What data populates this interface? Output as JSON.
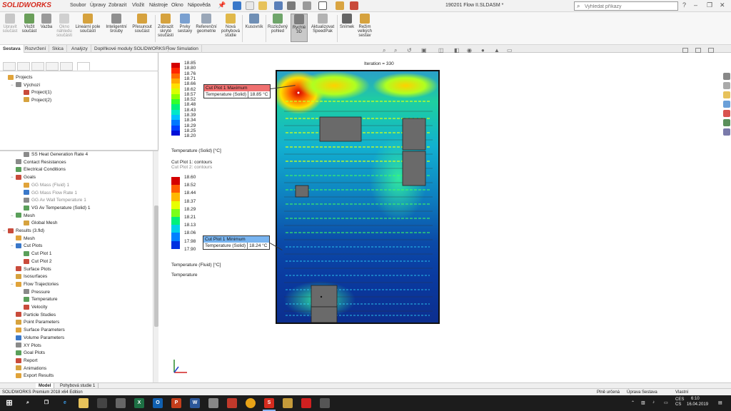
{
  "app": {
    "logo": "SOLIDWORKS",
    "menu": [
      "Soubor",
      "Úpravy",
      "Zobrazit",
      "Vložit",
      "Nástroje",
      "Okno",
      "Nápověda"
    ],
    "document_title": "190201 Flow II.SLDASM *",
    "search_placeholder": "Vyhledat příkazy",
    "colors": {
      "logo": "#d52b1e",
      "accent": "#1f6fd1",
      "max_callout": "#f07070",
      "min_callout": "#78b4f0"
    }
  },
  "ribbon": {
    "buttons": [
      {
        "label": "Upravit\nsoučást",
        "icon": "edit-component-icon",
        "disabled": true
      },
      {
        "label": "Vložit\nsoučást",
        "icon": "insert-component-icon"
      },
      {
        "label": "Vazba",
        "icon": "mate-icon"
      },
      {
        "label": "Okno\nnáhledu\nsoučásti",
        "icon": "preview-window-icon",
        "disabled": true
      },
      {
        "label": "Lineární pole\nsoučástí",
        "icon": "linear-pattern-icon"
      },
      {
        "label": "Inteligentní\nšrouby",
        "icon": "smart-fasteners-icon"
      },
      {
        "label": "Přesunout\nsoučást",
        "icon": "move-component-icon"
      },
      {
        "label": "Zobrazit\nskryté\nsoučásti",
        "icon": "show-hidden-icon"
      },
      {
        "label": "Prvky\nsestavy",
        "icon": "assembly-features-icon"
      },
      {
        "label": "Referenční\ngeometrie",
        "icon": "reference-geometry-icon"
      },
      {
        "label": "Nová\npohybová\nstudie",
        "icon": "motion-study-icon"
      },
      {
        "label": "Kusovník",
        "icon": "bom-icon"
      },
      {
        "label": "Rozložený\npohled",
        "icon": "exploded-view-icon"
      },
      {
        "label": "Rychlé\n3D",
        "icon": "instant3d-icon",
        "active": true
      },
      {
        "label": "Aktualizovat\nSpeedPak",
        "icon": "speedpak-icon"
      },
      {
        "label": "Snímek",
        "icon": "snapshot-icon"
      },
      {
        "label": "Režim\nvelkých\nsestav",
        "icon": "large-assembly-icon"
      }
    ]
  },
  "command_tabs": [
    "Sestava",
    "Rozvržení",
    "Skica",
    "Analýzy",
    "Doplňkové moduly SOLIDWORKS",
    "Flow Simulation"
  ],
  "tree_top": [
    {
      "label": "Projects",
      "indent": 0,
      "exp": ""
    },
    {
      "label": "Výchozí",
      "indent": 1,
      "exp": "−"
    },
    {
      "label": "Project(1)",
      "indent": 2,
      "exp": ""
    },
    {
      "label": "Project(2)",
      "indent": 2,
      "exp": ""
    }
  ],
  "tree": [
    {
      "label": "SS Heat Generation Rate 4",
      "indent": 2,
      "exp": "",
      "grey": false
    },
    {
      "label": "Contact Resistances",
      "indent": 1,
      "exp": "",
      "grey": false
    },
    {
      "label": "Electrical Conditions",
      "indent": 1,
      "exp": "",
      "grey": false
    },
    {
      "label": "Goals",
      "indent": 1,
      "exp": "−",
      "grey": false
    },
    {
      "label": "GG Mass (Fluid) 1",
      "indent": 2,
      "exp": "",
      "grey": true
    },
    {
      "label": "GG Mass Flow Rate 1",
      "indent": 2,
      "exp": "",
      "grey": true
    },
    {
      "label": "GG Av Wall Temperature 1",
      "indent": 2,
      "exp": "",
      "grey": true
    },
    {
      "label": "VG Av Temperature (Solid) 1",
      "indent": 2,
      "exp": "",
      "grey": false
    },
    {
      "label": "Mesh",
      "indent": 1,
      "exp": "−",
      "grey": false
    },
    {
      "label": "Global Mesh",
      "indent": 2,
      "exp": "",
      "grey": false
    },
    {
      "label": "Results (3.fld)",
      "indent": 0,
      "exp": "−",
      "grey": false
    },
    {
      "label": "Mesh",
      "indent": 1,
      "exp": "",
      "grey": false
    },
    {
      "label": "Cut Plots",
      "indent": 1,
      "exp": "−",
      "grey": false
    },
    {
      "label": "Cut Plot 1",
      "indent": 2,
      "exp": "",
      "grey": false
    },
    {
      "label": "Cut Plot 2",
      "indent": 2,
      "exp": "",
      "grey": false
    },
    {
      "label": "Surface Plots",
      "indent": 1,
      "exp": "",
      "grey": false
    },
    {
      "label": "Isosurfaces",
      "indent": 1,
      "exp": "",
      "grey": false
    },
    {
      "label": "Flow Trajectories",
      "indent": 1,
      "exp": "−",
      "grey": false
    },
    {
      "label": "Pressure",
      "indent": 2,
      "exp": "",
      "grey": false
    },
    {
      "label": "Temperature",
      "indent": 2,
      "exp": "",
      "grey": false
    },
    {
      "label": "Velocity",
      "indent": 2,
      "exp": "",
      "grey": false
    },
    {
      "label": "Particle Studies",
      "indent": 1,
      "exp": "",
      "grey": false
    },
    {
      "label": "Point Parameters",
      "indent": 1,
      "exp": "",
      "grey": false
    },
    {
      "label": "Surface Parameters",
      "indent": 1,
      "exp": "",
      "grey": false
    },
    {
      "label": "Volume Parameters",
      "indent": 1,
      "exp": "",
      "grey": false
    },
    {
      "label": "XY Plots",
      "indent": 1,
      "exp": "",
      "grey": false
    },
    {
      "label": "Goal Plots",
      "indent": 1,
      "exp": "",
      "grey": false
    },
    {
      "label": "Report",
      "indent": 1,
      "exp": "",
      "grey": false
    },
    {
      "label": "Animations",
      "indent": 1,
      "exp": "",
      "grey": false
    },
    {
      "label": "Export Results",
      "indent": 1,
      "exp": "",
      "grey": false
    }
  ],
  "viewport": {
    "iteration": "Iteration = 330",
    "legend_solid": {
      "values": [
        "18.85",
        "18.80",
        "18.76",
        "18.71",
        "18.66",
        "18.62",
        "18.57",
        "18.52",
        "18.48",
        "18.43",
        "18.39",
        "18.34",
        "18.29",
        "18.25",
        "18.20"
      ],
      "caption": "Temperature (Solid) [°C]"
    },
    "cut_plot_1": "Cut Plot 1: contours",
    "cut_plot_2": "Cut Plot 2: contours",
    "legend_fluid": {
      "values": [
        "18.60",
        "18.52",
        "18.44",
        "18.37",
        "18.29",
        "18.21",
        "18.13",
        "18.06",
        "17.98",
        "17.90"
      ],
      "caption": "Temperature (Fluid) [°C]"
    },
    "trajectory_caption": "Temperature",
    "max_callout": {
      "title": "Cut Plot 1 Maximum",
      "param": "Temperature (Solid)",
      "value": "18.85 °C"
    },
    "min_callout": {
      "title": "Cut Plot 1 Minimum",
      "param": "Temperature (Solid)",
      "value": "18.24 °C"
    }
  },
  "bottom_tabs": [
    "Model",
    "Pohybová studie 1"
  ],
  "status": {
    "edition": "SOLIDWORKS Premium 2018 x64 Edition",
    "defined": "Plně určená",
    "editing": "Úprava Sestava",
    "units": "Vlastní"
  },
  "taskbar": {
    "lang": "CES\nCS",
    "time": "6:10",
    "date": "16.04.2019"
  }
}
